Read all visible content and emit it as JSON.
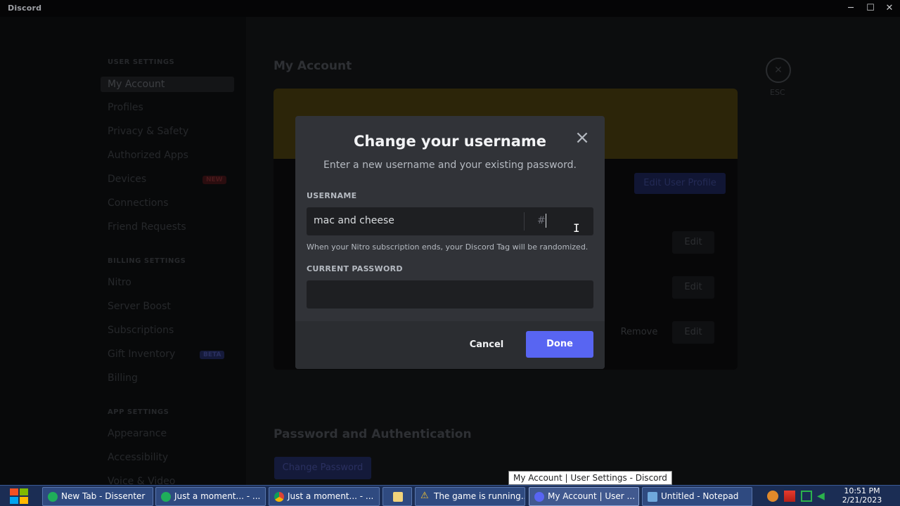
{
  "window": {
    "app_name": "Discord",
    "minimize": "─",
    "maximize": "☐",
    "close": "✕"
  },
  "sidebar": {
    "user_settings_header": "USER SETTINGS",
    "user_items": [
      "My Account",
      "Profiles",
      "Privacy & Safety",
      "Authorized Apps",
      "Devices",
      "Connections",
      "Friend Requests"
    ],
    "devices_badge": "NEW",
    "billing_header": "BILLING SETTINGS",
    "billing_items": [
      "Nitro",
      "Server Boost",
      "Subscriptions",
      "Gift Inventory",
      "Billing"
    ],
    "gift_badge": "BETA",
    "app_header": "APP SETTINGS",
    "app_items": [
      "Appearance",
      "Accessibility",
      "Voice & Video"
    ]
  },
  "account": {
    "title": "My Account",
    "edit_profile": "Edit User Profile",
    "edit_label": "Edit",
    "remove_label": "Remove",
    "esc_label": "ESC",
    "pw_section": "Password and Authentication",
    "change_password": "Change Password"
  },
  "modal": {
    "title": "Change your username",
    "subtitle": "Enter a new username and your existing password.",
    "username_label": "USERNAME",
    "username_value": "mac and cheese",
    "hash": "#",
    "hint": "When your Nitro subscription ends, your Discord Tag will be randomized.",
    "password_label": "CURRENT PASSWORD",
    "password_value": "",
    "cancel": "Cancel",
    "done": "Done"
  },
  "tooltip": "My Account | User Settings - Discord",
  "taskbar": {
    "items": [
      {
        "label": "New Tab - Dissenter",
        "color": "#1fae5a"
      },
      {
        "label": "Just a moment... - ...",
        "color": "#1fae5a"
      },
      {
        "label": "Just a moment... - ...",
        "color": "#e8b400"
      },
      {
        "label": "",
        "color": "#f1d37a"
      },
      {
        "label": "The game is running...",
        "color": "#f4c430"
      },
      {
        "label": "My Account | User ...",
        "color": "#5865f2"
      },
      {
        "label": "Untitled - Notepad",
        "color": "#6fa8dc"
      }
    ],
    "time": "10:51 PM",
    "date": "2/21/2023"
  },
  "colors": {
    "accent": "#5865f2",
    "modal_bg": "#313338",
    "input_bg": "#1e1f22"
  }
}
